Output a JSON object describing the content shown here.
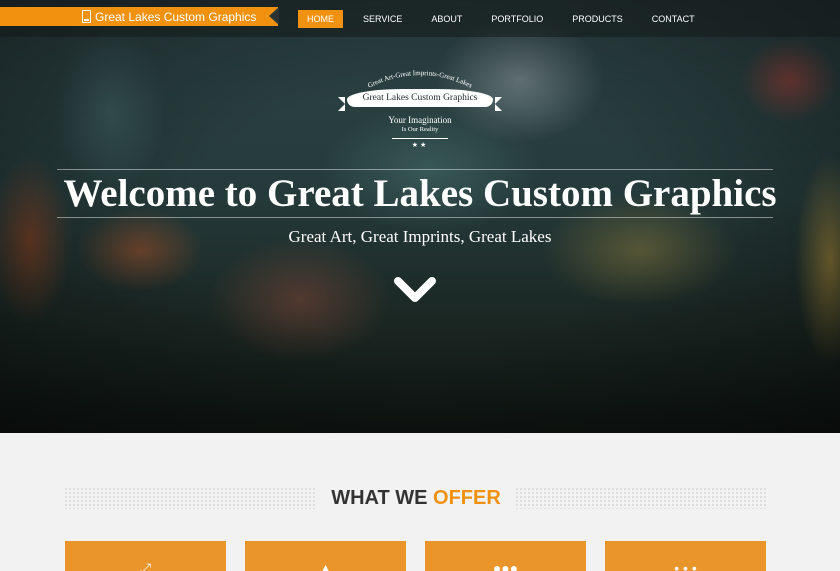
{
  "brand": {
    "title": "Great Lakes Custom Graphics",
    "accent": "#f0920f"
  },
  "nav": {
    "items": [
      {
        "label": "HOME",
        "active": true
      },
      {
        "label": "SERVICE",
        "active": false
      },
      {
        "label": "ABOUT",
        "active": false
      },
      {
        "label": "PORTFOLIO",
        "active": false
      },
      {
        "label": "PRODUCTS",
        "active": false
      },
      {
        "label": "CONTACT",
        "active": false
      }
    ]
  },
  "logo": {
    "arc_text": "Great Art-Great Imprints-Great Lakes",
    "ribbon_text": "Great Lakes Custom Graphics",
    "line1": "Your Imagination",
    "line2": "Is Our Reality",
    "stars": "★★"
  },
  "hero": {
    "headline": "Welcome to Great Lakes Custom Graphics",
    "tagline": "Great Art, Great Imprints, Great Lakes",
    "scroll_icon": "chevron-down-icon"
  },
  "section": {
    "title_main": "WHAT WE ",
    "title_accent": "OFFER"
  },
  "cards": [
    {
      "icon": "expand-arrows-icon",
      "glyph": "⤢"
    },
    {
      "icon": "triangle-icon",
      "glyph": "▲"
    },
    {
      "icon": "people-icon",
      "glyph": "●●●"
    },
    {
      "icon": "dots-icon",
      "glyph": "• • •"
    }
  ]
}
